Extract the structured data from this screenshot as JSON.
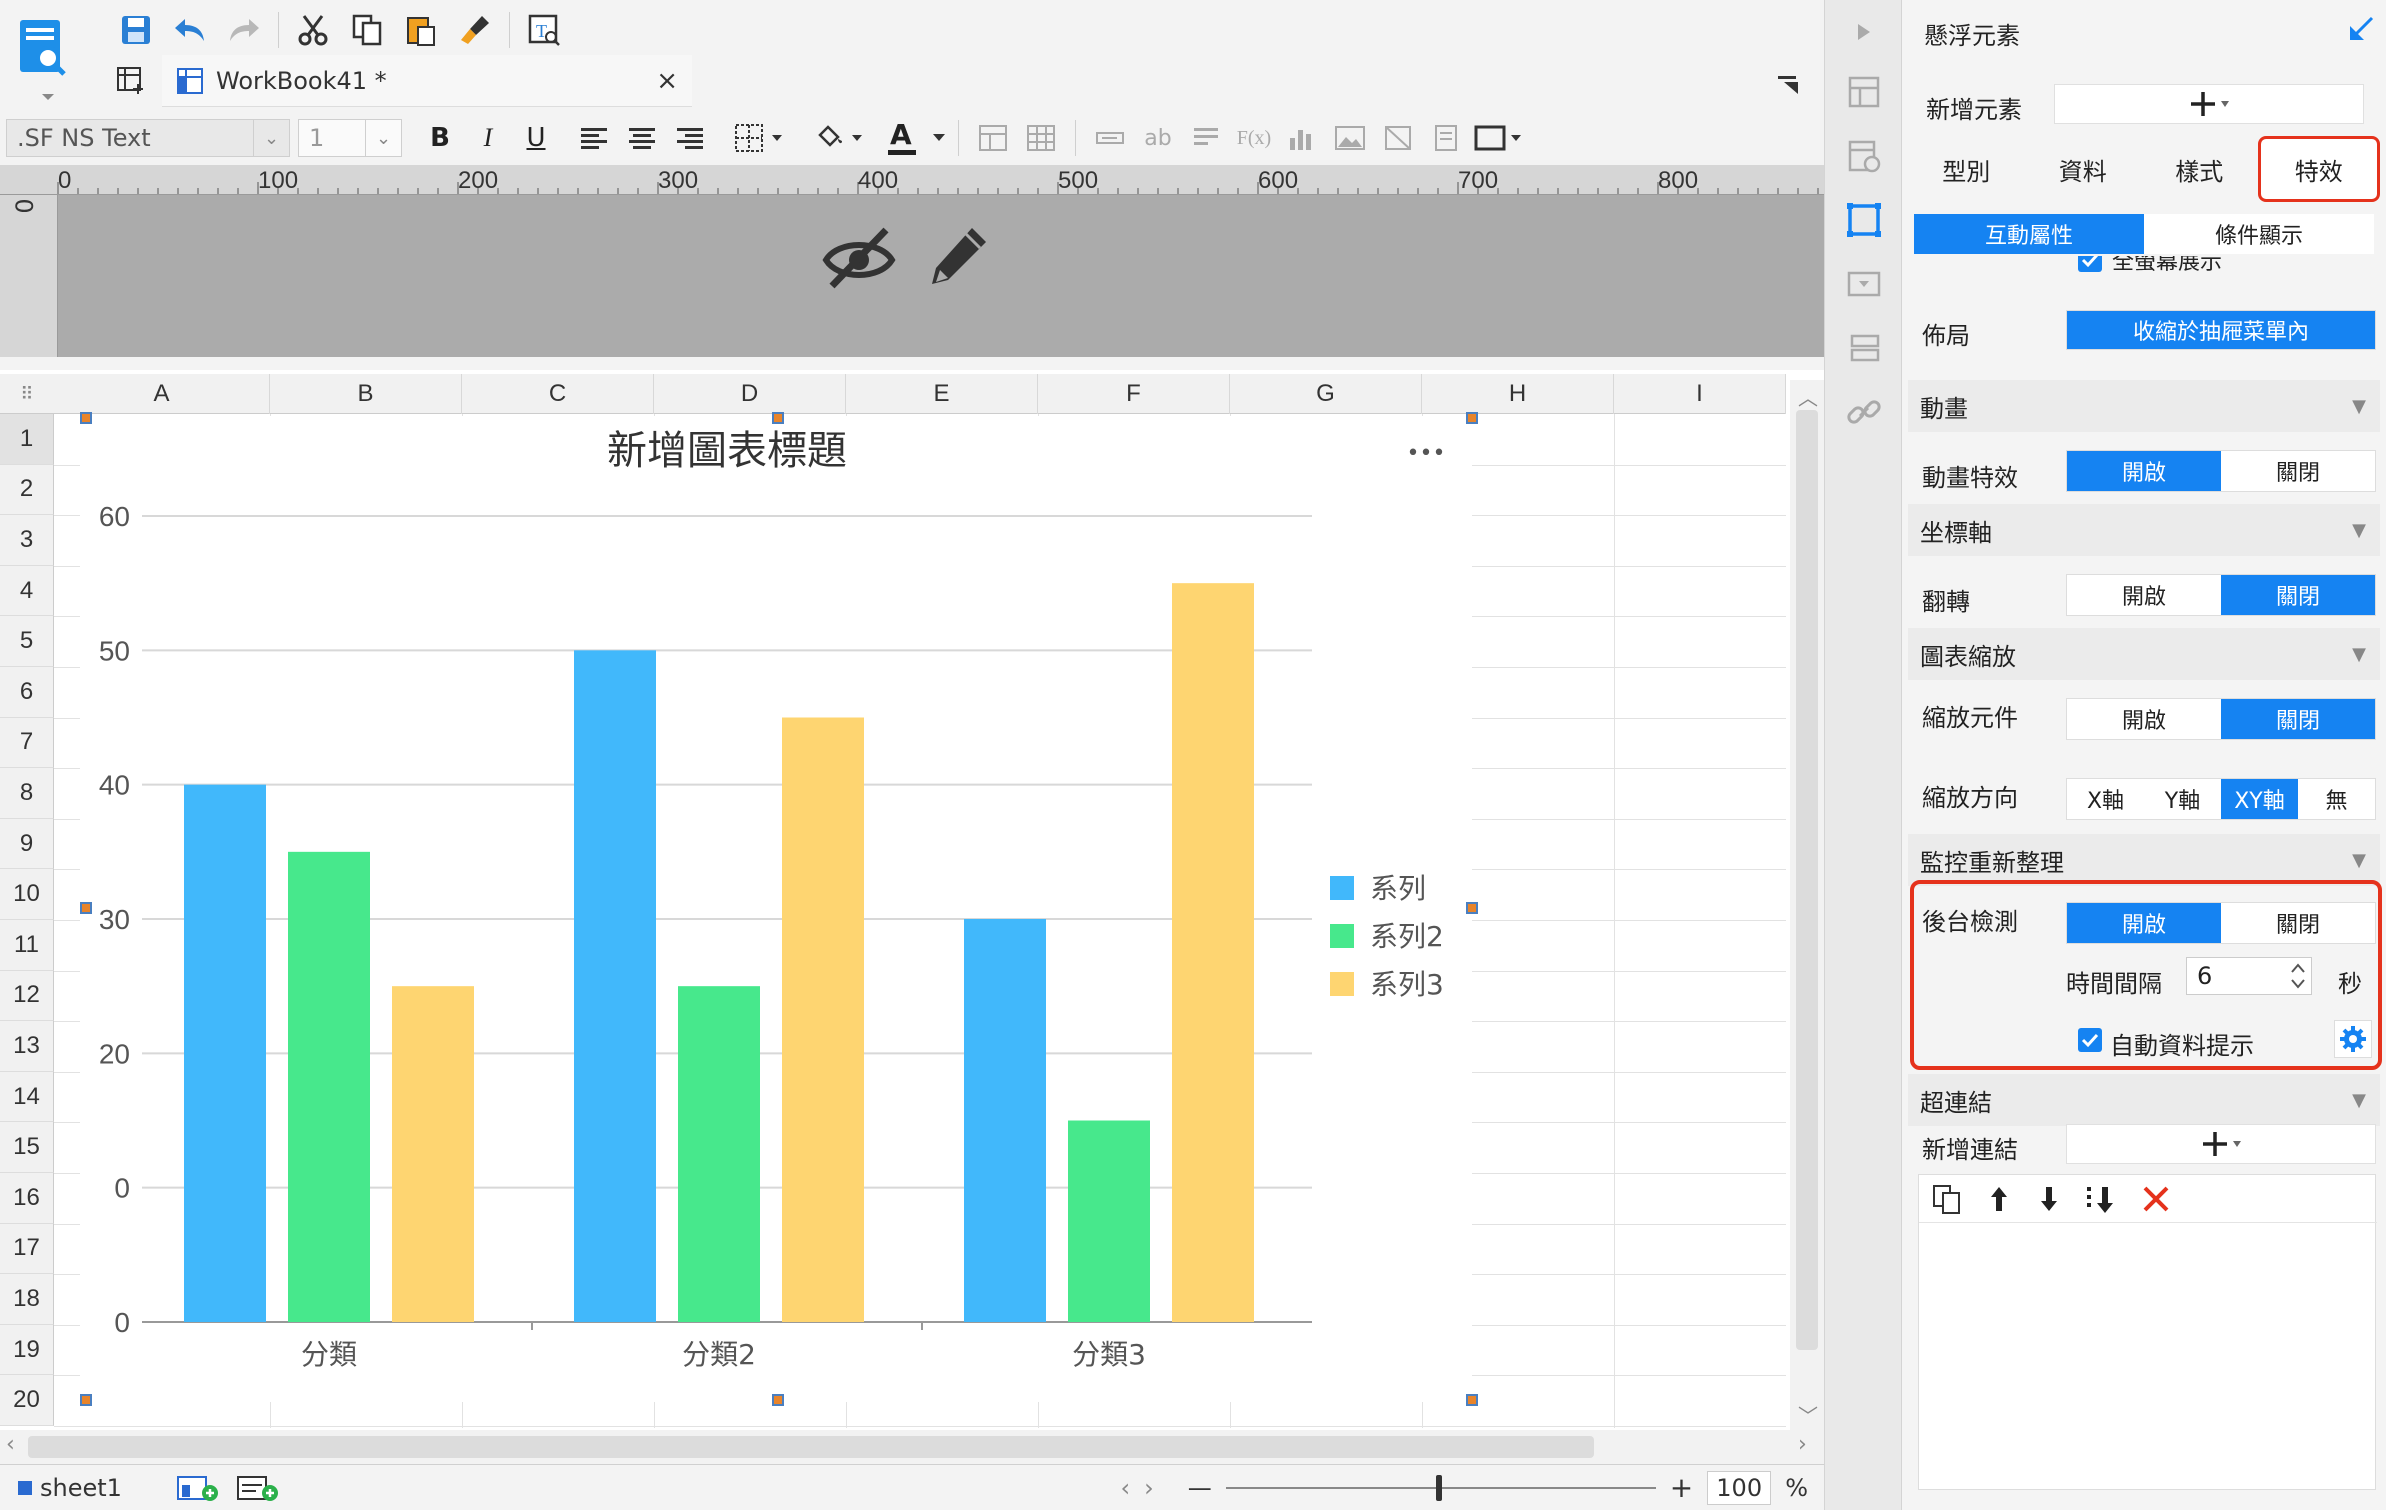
{
  "toolbar": {
    "workbook_tab": "WorkBook41 *",
    "tab_close": "×",
    "font_name": ".SF NS Text",
    "font_size": "1",
    "bold": "B",
    "italic": "I",
    "underline": "U",
    "text_color_glyph": "A",
    "ab_glyph": "ab",
    "fx_glyph": "F(x)"
  },
  "ruler": {
    "marks": [
      "0",
      "100",
      "200",
      "300",
      "400",
      "500",
      "600",
      "700",
      "800"
    ],
    "vertical_zero": "0"
  },
  "grid": {
    "columns": [
      "A",
      "B",
      "C",
      "D",
      "E",
      "F",
      "G",
      "H",
      "I"
    ],
    "rows": [
      "1",
      "2",
      "3",
      "4",
      "5",
      "6",
      "7",
      "8",
      "9",
      "10",
      "11",
      "12",
      "13",
      "14",
      "15",
      "16",
      "17",
      "18",
      "19",
      "20"
    ]
  },
  "chart_data": {
    "type": "bar",
    "title": "新增圖表標題",
    "more_glyph": "•••",
    "categories": [
      "分類",
      "分類2",
      "分類3"
    ],
    "series": [
      {
        "name": "系列",
        "values": [
          40,
          50,
          30
        ],
        "color": "#41b8fb"
      },
      {
        "name": "系列2",
        "values": [
          35,
          25,
          15
        ],
        "color": "#47e88c"
      },
      {
        "name": "系列3",
        "values": [
          25,
          45,
          55
        ],
        "color": "#fed571"
      }
    ],
    "yticks": [
      "0",
      "0",
      "20",
      "30",
      "40",
      "50",
      "60"
    ],
    "ylim": [
      0,
      60
    ],
    "legend_position": "right",
    "grid": true
  },
  "statusbar": {
    "sheet_name": "sheet1",
    "zoom_minus": "—",
    "zoom_plus": "+",
    "zoom_value": "100",
    "zoom_unit": "%"
  },
  "panel": {
    "title": "懸浮元素",
    "add_element_label": "新增元素",
    "tabs": [
      "型別",
      "資料",
      "樣式",
      "特效"
    ],
    "subtabs": [
      "互動屬性",
      "條件顯示"
    ],
    "fullscreen_label": "全螢幕展示",
    "layout_label": "佈局",
    "layout_value": "收縮於抽屜菜單內",
    "animation_section": "動畫",
    "animation_effect_label": "動畫特效",
    "on": "開啟",
    "off": "關閉",
    "axis_section": "坐標軸",
    "flip_label": "翻轉",
    "zoom_section": "圖表縮放",
    "zoom_component_label": "縮放元件",
    "zoom_direction_label": "縮放方向",
    "zoom_directions": [
      "X軸",
      "Y軸",
      "XY軸",
      "無"
    ],
    "monitor_section": "監控重新整理",
    "background_check_label": "後台檢測",
    "interval_label": "時間間隔",
    "interval_value": "6",
    "interval_unit": "秒",
    "auto_tip_label": "自動資料提示",
    "hyperlink_section": "超連結",
    "add_link_label": "新增連結"
  }
}
